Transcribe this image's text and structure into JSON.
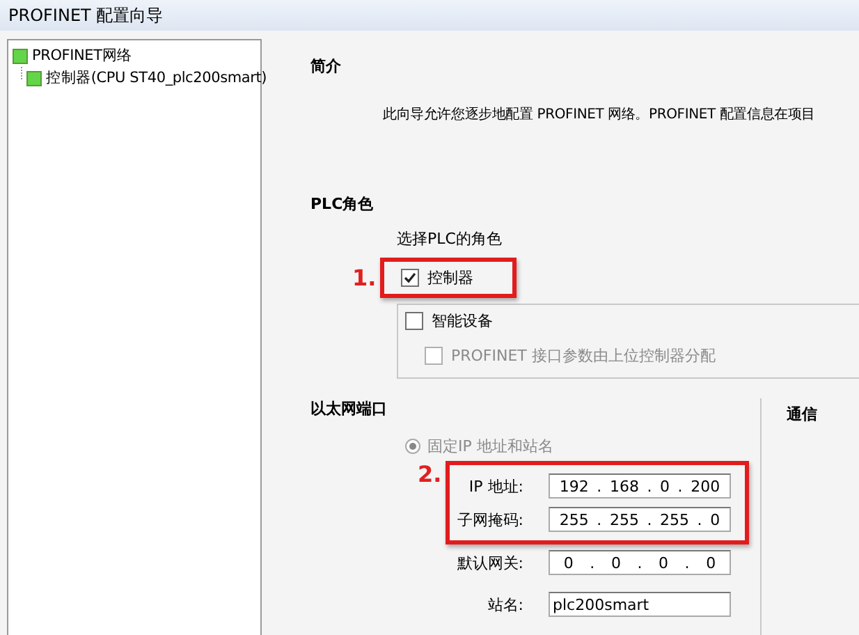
{
  "window": {
    "title": "PROFINET 配置向导"
  },
  "tree": [
    {
      "label": "PROFINET网络",
      "children": [
        {
          "label": "控制器(CPU ST40_plc200smart)"
        }
      ]
    }
  ],
  "intro": {
    "heading": "简介",
    "text": "此向导允许您逐步地配置 PROFINET 网络。PROFINET 配置信息在项目"
  },
  "plc_role": {
    "heading": "PLC角色",
    "prompt": "选择PLC的角色",
    "marker": "1.",
    "controller": {
      "label": "控制器",
      "checked": true
    },
    "device": {
      "label": "智能设备",
      "checked": false
    },
    "device_option": {
      "label": "PROFINET 接口参数由上位控制器分配",
      "checked": false,
      "disabled": true
    }
  },
  "ethernet": {
    "heading": "以太网端口",
    "radio": {
      "label": "固定IP 地址和站名",
      "selected": true,
      "disabled": true
    },
    "marker": "2.",
    "highlighted_fields": [
      {
        "kind": "ip",
        "label": "IP 地址:",
        "octets": [
          "192",
          "168",
          "0",
          "200"
        ],
        "separators": [
          ".",
          ".",
          "."
        ]
      },
      {
        "kind": "ip",
        "label": "子网掩码:",
        "octets": [
          "255",
          "255",
          "255",
          "0"
        ],
        "separators": [
          ".",
          ".",
          "."
        ]
      }
    ],
    "fields": [
      {
        "kind": "ip",
        "label": "默认网关:",
        "octets": [
          "0",
          "0",
          "0",
          "0"
        ],
        "separators": [
          ".",
          ".",
          "."
        ]
      },
      {
        "kind": "text",
        "label": "站名:",
        "value": "plc200smart"
      }
    ]
  },
  "communication": {
    "heading": "通信"
  }
}
